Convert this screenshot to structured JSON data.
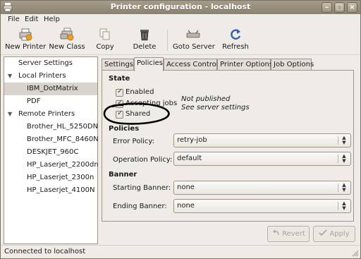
{
  "window": {
    "title": "Printer configuration - localhost"
  },
  "menubar": {
    "file": "File",
    "edit": "Edit",
    "help": "Help"
  },
  "toolbar": {
    "new_printer": "New Printer",
    "new_class": "New Class",
    "copy": "Copy",
    "delete": "Delete",
    "goto_server": "Goto Server",
    "refresh": "Refresh"
  },
  "tree": {
    "server_settings": "Server Settings",
    "local_printers": "Local Printers",
    "local_items": [
      "IBM_DotMatrix",
      "PDF"
    ],
    "remote_printers": "Remote Printers",
    "remote_items": [
      "Brother_HL_5250DN",
      "Brother_MFC_8460N",
      "DESKJET_960C",
      "HP_Laserjet_2200dn",
      "HP_Laserjet_2300n",
      "HP_Laserjet_4100N"
    ],
    "selected": "IBM_DotMatrix"
  },
  "tabs": [
    "Settings",
    "Policies",
    "Access Control",
    "Printer Options",
    "Job Options"
  ],
  "active_tab": "Policies",
  "state": {
    "heading": "State",
    "enabled": "Enabled",
    "accepting": "Accepting jobs",
    "shared": "Shared",
    "publish_line1": "Not published",
    "publish_line2": "See server settings"
  },
  "policies": {
    "heading": "Policies",
    "error_label": "Error Policy:",
    "error_value": "retry-job",
    "operation_label": "Operation Policy:",
    "operation_value": "default"
  },
  "banner": {
    "heading": "Banner",
    "starting_label": "Starting Banner:",
    "starting_value": "none",
    "ending_label": "Ending Banner:",
    "ending_value": "none"
  },
  "buttons": {
    "revert": "Revert",
    "apply": "Apply"
  },
  "status": {
    "text": "Connected to localhost"
  },
  "colors": {
    "titlebar": "#8c8271",
    "selection": "#d8d3cc",
    "annotation_ring": "#000000"
  }
}
